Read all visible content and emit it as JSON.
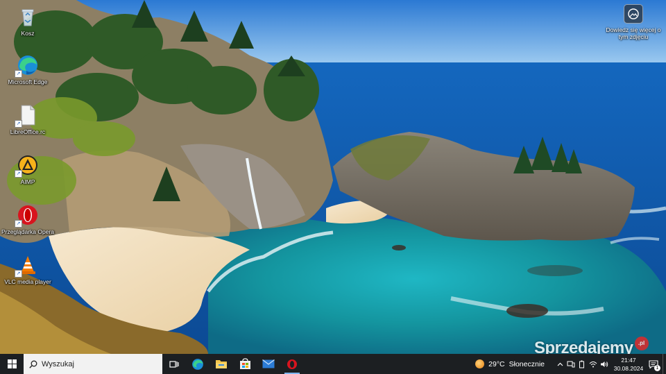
{
  "desktop": {
    "icons": [
      {
        "label": "Kosz",
        "icon": "recycle-bin-icon"
      },
      {
        "label": "Microsoft Edge",
        "icon": "edge-icon"
      },
      {
        "label": "LibreOffice.rc",
        "icon": "file-icon"
      },
      {
        "label": "AIMP",
        "icon": "aimp-icon"
      },
      {
        "label": "Przeglądarka Opera",
        "icon": "opera-icon"
      },
      {
        "label": "VLC media player",
        "icon": "vlc-icon"
      }
    ],
    "learn_more": {
      "label": "Dowiedz się więcej o tym zdjęciu",
      "icon": "camera-icon"
    }
  },
  "watermark": {
    "text": "Sprzedajemy",
    "badge": ".pl"
  },
  "taskbar": {
    "search_placeholder": "Wyszukaj",
    "pinned": [
      {
        "name": "task-view",
        "icon": "task-view-icon"
      },
      {
        "name": "edge",
        "icon": "edge-icon"
      },
      {
        "name": "file-explorer",
        "icon": "folder-icon"
      },
      {
        "name": "store",
        "icon": "store-icon"
      },
      {
        "name": "mail",
        "icon": "mail-icon"
      },
      {
        "name": "opera",
        "icon": "opera-icon"
      }
    ],
    "weather": {
      "temp": "29°C",
      "condition": "Słonecznie"
    },
    "clock": {
      "time": "21:47",
      "date": "30.08.2024"
    },
    "notifications": {
      "count": "1"
    }
  },
  "colors": {
    "taskbar": "#1c1f22",
    "search": "#f2f2f2",
    "accent": "#7fb6ef",
    "watermark_badge": "#e02a2a"
  }
}
